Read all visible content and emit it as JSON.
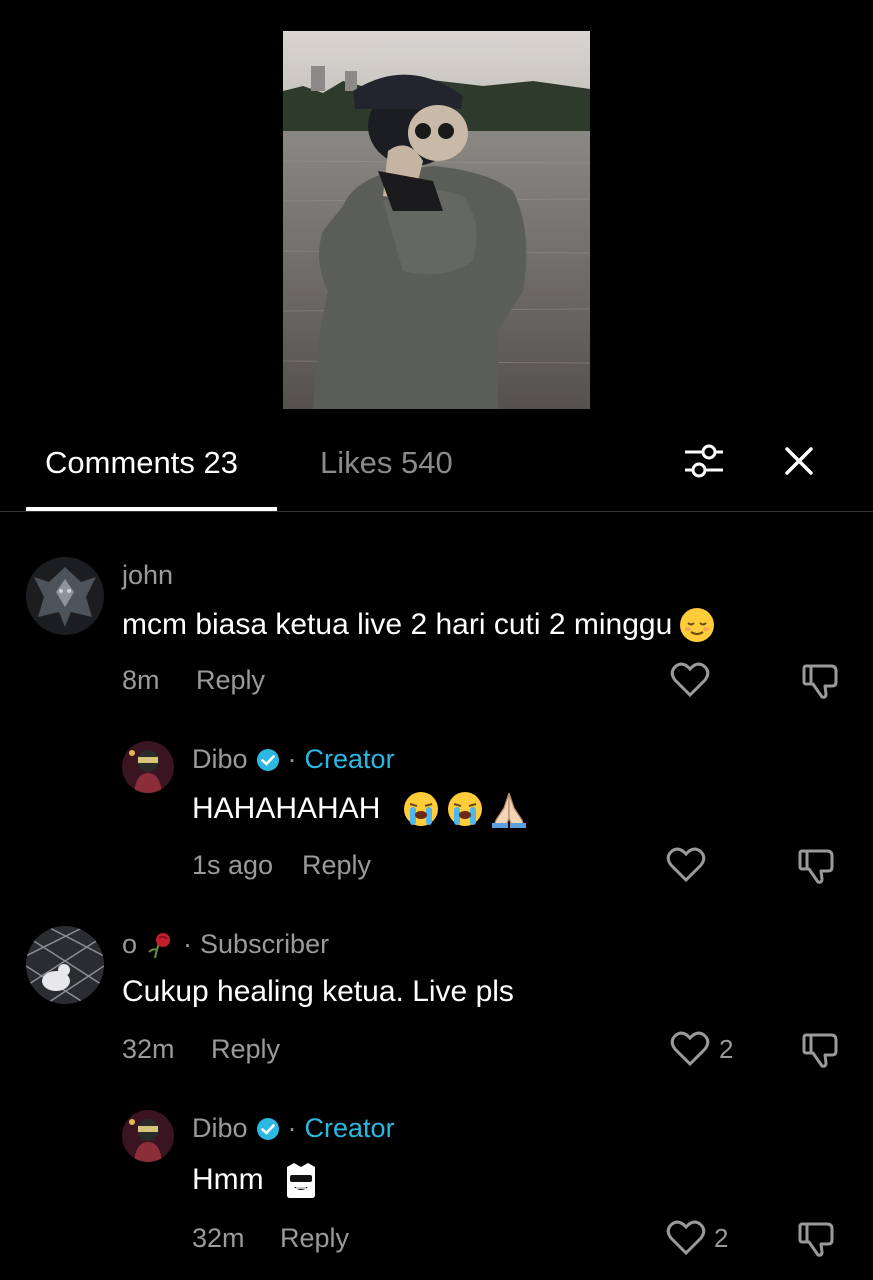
{
  "tabs": {
    "comments": "Comments 23",
    "likes": "Likes 540"
  },
  "icons": {
    "filter": "sliders-filter-icon",
    "close": "close-icon",
    "heart": "heart-outline-icon",
    "dislike": "thumbs-down-icon",
    "verified": "verified-check-icon"
  },
  "colors": {
    "background": "#000000",
    "creator": "#2cb8e0",
    "secondary_text": "#9a9a9a"
  },
  "comments": [
    {
      "username": "john",
      "text": "mcm biasa ketua live 2 hari cuti 2 minggu",
      "time": "8m",
      "reply": "Reply",
      "emoji": [
        "relieved-face-emoji"
      ],
      "reply_item": {
        "username": "Dibo",
        "separator": "·",
        "badge": "Creator",
        "text": "HAHAHAHAH",
        "emoji": [
          "loudly-crying-face-emoji",
          "loudly-crying-face-emoji",
          "folded-hands-emoji"
        ],
        "time": "1s ago",
        "reply": "Reply"
      }
    },
    {
      "username": "o",
      "separator": "·",
      "badge": "Subscriber",
      "text": "Cukup healing ketua. Live pls",
      "time": "32m",
      "reply": "Reply",
      "likes": "2",
      "reply_item": {
        "username": "Dibo",
        "separator": "·",
        "badge": "Creator",
        "text": "Hmm",
        "emoji": [
          "sunglasses-ghost-emoji"
        ],
        "time": "32m",
        "reply": "Reply",
        "likes": "2"
      }
    }
  ]
}
